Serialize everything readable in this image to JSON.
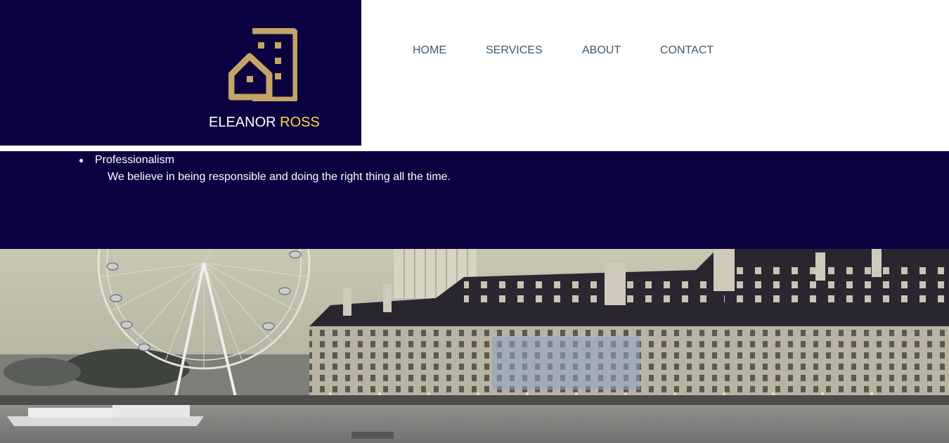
{
  "brand": {
    "logo_icon": "building-house-icon",
    "first_name": "ELEANOR",
    "last_name": "ROSS",
    "colors": {
      "background": "#0b0040",
      "accent": "#ffd84a",
      "logo": "#c5a565"
    }
  },
  "nav": {
    "items": [
      {
        "label": "HOME"
      },
      {
        "label": "SERVICES"
      },
      {
        "label": "ABOUT"
      },
      {
        "label": "CONTACT"
      }
    ],
    "color": "#3c5a6e"
  },
  "values": {
    "items": [
      {
        "title": "Professionalism",
        "description": "We believe in being responsible and doing the right thing all the time."
      }
    ]
  },
  "hero_image": {
    "subject": "photo"
  }
}
